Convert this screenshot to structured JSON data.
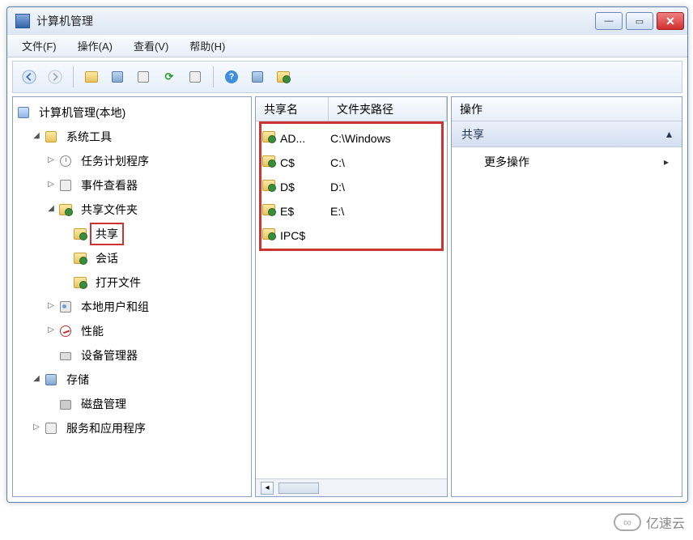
{
  "window": {
    "title": "计算机管理"
  },
  "menu": {
    "file": "文件(F)",
    "action": "操作(A)",
    "view": "查看(V)",
    "help": "帮助(H)"
  },
  "tree": {
    "root": "计算机管理(本地)",
    "system_tools": "系统工具",
    "task_scheduler": "任务计划程序",
    "event_viewer": "事件查看器",
    "shared_folders": "共享文件夹",
    "shares": "共享",
    "sessions": "会话",
    "open_files": "打开文件",
    "local_users": "本地用户和组",
    "performance": "性能",
    "device_manager": "设备管理器",
    "storage": "存储",
    "disk_mgmt": "磁盘管理",
    "services_apps": "服务和应用程序"
  },
  "list": {
    "col_name": "共享名",
    "col_path": "文件夹路径",
    "rows": [
      {
        "name": "AD...",
        "path": "C:\\Windows"
      },
      {
        "name": "C$",
        "path": "C:\\"
      },
      {
        "name": "D$",
        "path": "D:\\"
      },
      {
        "name": "E$",
        "path": "E:\\"
      },
      {
        "name": "IPC$",
        "path": ""
      }
    ]
  },
  "actions": {
    "header": "操作",
    "section": "共享",
    "more": "更多操作"
  },
  "watermark": "亿速云"
}
